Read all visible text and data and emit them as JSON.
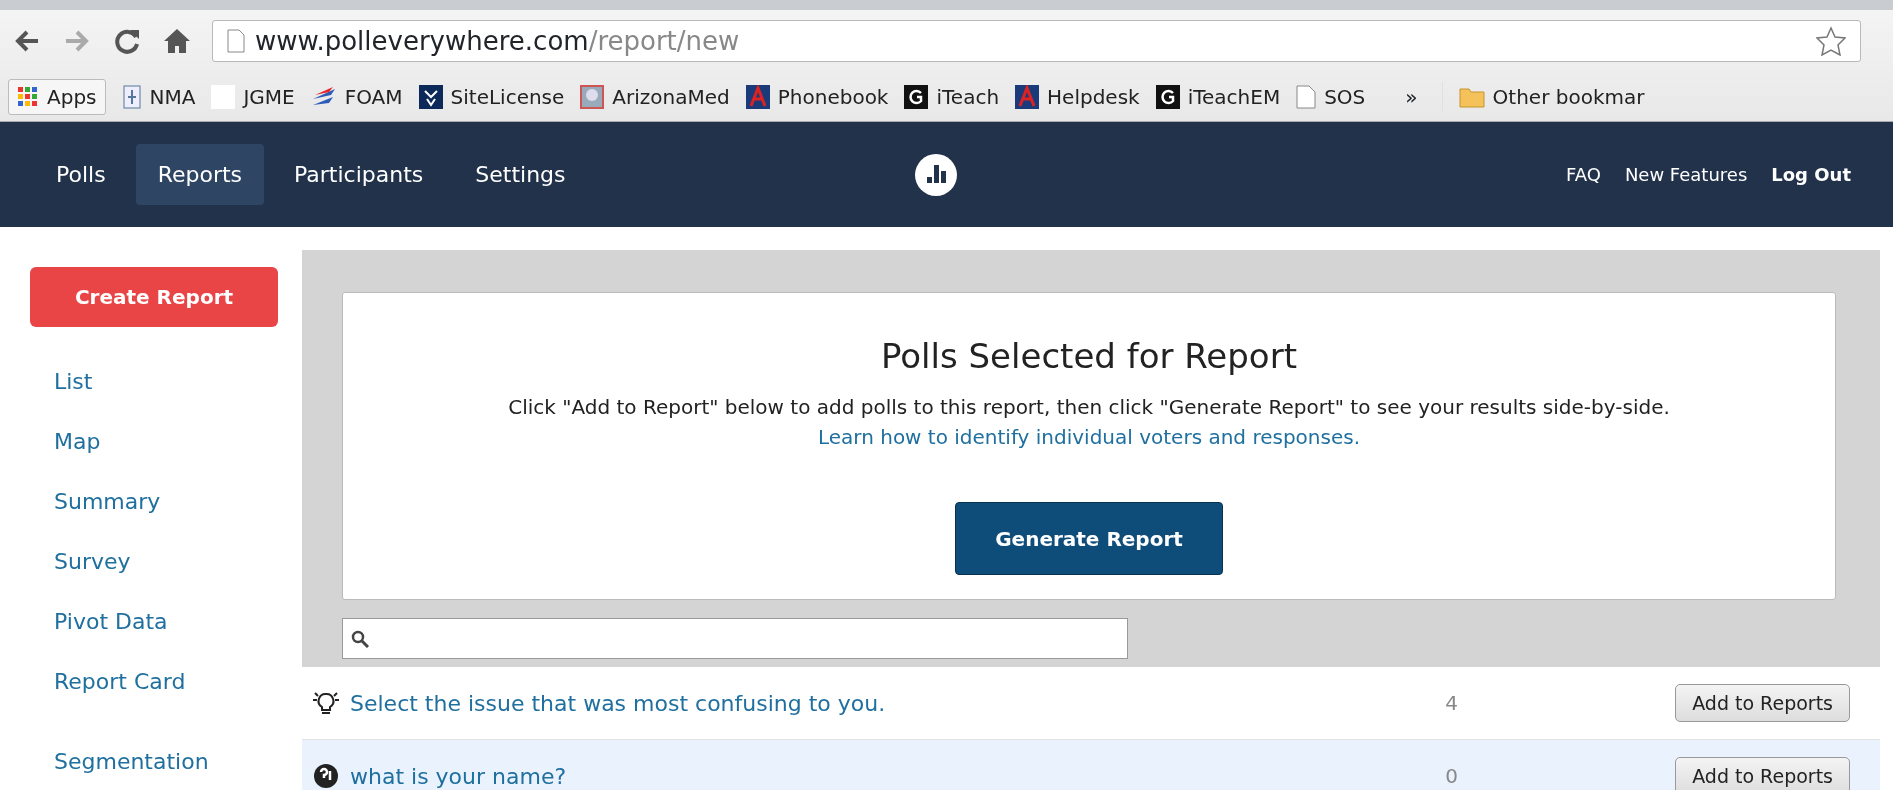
{
  "browser": {
    "url": {
      "host": "www.polleverywhere.com",
      "path": "/report/new"
    },
    "bookmarks": [
      {
        "label": "Apps",
        "kind": "grid"
      },
      {
        "label": "NMA",
        "kind": "doc"
      },
      {
        "label": "JGME",
        "kind": "blank"
      },
      {
        "label": "FOAM",
        "kind": "flag"
      },
      {
        "label": "SiteLicense",
        "kind": "seal"
      },
      {
        "label": "ArizonaMed",
        "kind": "photo"
      },
      {
        "label": "Phonebook",
        "kind": "letter-a"
      },
      {
        "label": "iTeach",
        "kind": "letter-g"
      },
      {
        "label": "Helpdesk",
        "kind": "letter-a"
      },
      {
        "label": "iTeachEM",
        "kind": "letter-g"
      },
      {
        "label": "SOS",
        "kind": "page"
      }
    ],
    "overflow": "»",
    "other": {
      "label": "Other bookmar",
      "kind": "folder"
    }
  },
  "navbar": {
    "items": [
      {
        "label": "Polls",
        "selected": false
      },
      {
        "label": "Reports",
        "selected": true
      },
      {
        "label": "Participants",
        "selected": false
      },
      {
        "label": "Settings",
        "selected": false
      }
    ],
    "links": [
      {
        "label": "FAQ",
        "emphasized": false
      },
      {
        "label": "New Features",
        "emphasized": false
      },
      {
        "label": "Log Out",
        "emphasized": true
      }
    ]
  },
  "sidebar": {
    "create_button": "Create Report",
    "sections": [
      {
        "items": [
          "List",
          "Map",
          "Summary",
          "Survey",
          "Pivot Data",
          "Report Card"
        ]
      },
      {
        "items": [
          "Segmentation"
        ]
      }
    ]
  },
  "report_card": {
    "title": "Polls Selected for Report",
    "instruction": "Click \"Add to Report\" below to add polls to this report, then click \"Generate Report\" to see your results side-by-side.",
    "help_link": "Learn how to identify individual voters and responses.",
    "button": "Generate Report"
  },
  "polls": [
    {
      "kind": "open",
      "title": "Select the issue that was most confusing to you.",
      "count": "4",
      "button": "Add to Reports",
      "highlighted": false
    },
    {
      "kind": "name",
      "title": "what is your name?",
      "count": "0",
      "button": "Add to Reports",
      "highlighted": true
    }
  ]
}
